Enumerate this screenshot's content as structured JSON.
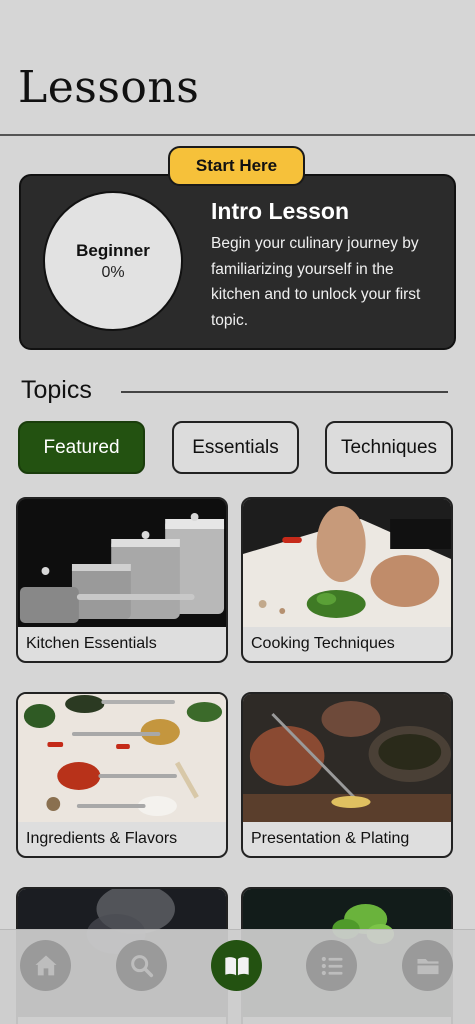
{
  "header": {
    "title": "Lessons"
  },
  "intro": {
    "badge_label": "Start Here",
    "level": "Beginner",
    "progress_text": "0%",
    "title": "Intro Lesson",
    "description": "Begin your culinary journey by familiarizing yourself in the kitchen and to unlock your first topic."
  },
  "topics": {
    "heading": "Topics",
    "tabs": [
      {
        "label": "Featured",
        "active": true
      },
      {
        "label": "Essentials",
        "active": false
      },
      {
        "label": "Techniques",
        "active": false
      }
    ],
    "cards": [
      {
        "label": "Kitchen Essentials",
        "image": "stainless-pots-photo"
      },
      {
        "label": "Cooking Techniques",
        "image": "chopping-herbs-photo"
      },
      {
        "label": "Ingredients & Flavors",
        "image": "spice-spoons-photo"
      },
      {
        "label": "Presentation & Plating",
        "image": "plating-dish-photo"
      },
      {
        "label": "",
        "image": "smoke-pan-photo"
      },
      {
        "label": "",
        "image": "fresh-herb-photo"
      }
    ]
  },
  "nav": {
    "items": [
      {
        "icon": "home-icon",
        "active": false
      },
      {
        "icon": "search-icon",
        "active": false
      },
      {
        "icon": "book-icon",
        "active": true
      },
      {
        "icon": "list-icon",
        "active": false
      },
      {
        "icon": "folder-icon",
        "active": false
      }
    ]
  },
  "colors": {
    "accent_green": "#235211",
    "badge_yellow": "#f6c13a",
    "card_dark": "#2b2b2b",
    "background": "#d6d6d6"
  }
}
